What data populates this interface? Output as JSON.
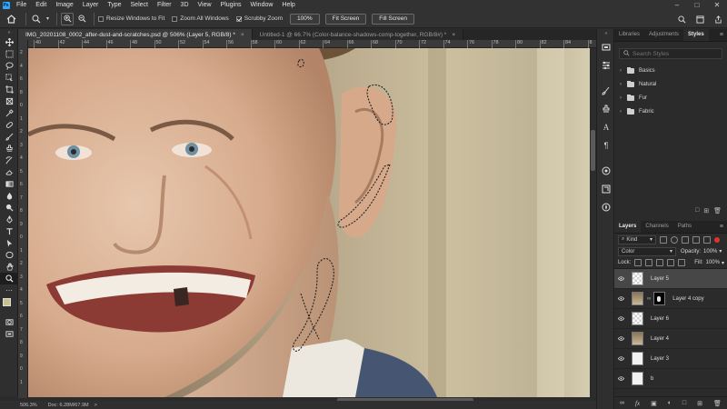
{
  "menubar": {
    "app_logo": "Ps",
    "items": [
      "File",
      "Edit",
      "Image",
      "Layer",
      "Type",
      "Select",
      "Filter",
      "3D",
      "View",
      "Plugins",
      "Window",
      "Help"
    ]
  },
  "options": {
    "resize_windows_label": "Resize Windows to Fit",
    "resize_windows_checked": false,
    "zoom_all_label": "Zoom All Windows",
    "zoom_all_checked": false,
    "scrubby_label": "Scrubby Zoom",
    "scrubby_checked": true,
    "zoom_100_label": "100%",
    "fit_screen_label": "Fit Screen",
    "fill_screen_label": "Fill Screen"
  },
  "tabs": [
    {
      "label": "IMG_20201108_0002_after-dust-and-scratches.psd @ 506% (Layer 5, RGB/8) *",
      "active": true
    },
    {
      "label": "Untitled-1 @ 66.7% (Color-balance-shadows-comp-together, RGB/8#) *",
      "active": false
    }
  ],
  "ruler": {
    "h_ticks": [
      "40",
      "42",
      "44",
      "46",
      "48",
      "50",
      "52",
      "54",
      "56",
      "58",
      "60",
      "62",
      "64",
      "66",
      "68",
      "70",
      "72",
      "74",
      "76",
      "78",
      "80",
      "82",
      "84",
      "8"
    ],
    "v_ticks": [
      "2",
      "4",
      "6",
      "8",
      "0",
      "1",
      "2",
      "3",
      "4",
      "5",
      "6",
      "7",
      "8",
      "9",
      "0",
      "1",
      "2",
      "3",
      "4",
      "5",
      "6",
      "7",
      "8",
      "9",
      "0",
      "1"
    ]
  },
  "status": {
    "zoom": "506.3%",
    "doc": "Doc: 6.28M/67.9M",
    "arrow": ">"
  },
  "styles_panel": {
    "tabs": [
      "Libraries",
      "Adjustments",
      "Styles"
    ],
    "active_tab": "Styles",
    "search_placeholder": "Search Styles",
    "folders": [
      "Basics",
      "Natural",
      "Fur",
      "Fabric"
    ]
  },
  "layers_panel": {
    "tabs": [
      "Layers",
      "Channels",
      "Paths"
    ],
    "active_tab": "Layers",
    "filter_kind": "Kind",
    "blend_mode": "Color",
    "opacity_label": "Opacity:",
    "opacity_value": "100%",
    "lock_label": "Lock:",
    "fill_label": "Fill:",
    "fill_value": "100%",
    "layers": [
      {
        "name": "Layer 5",
        "thumb": "transparent",
        "selected": true,
        "mask": false
      },
      {
        "name": "Layer 4 copy",
        "thumb": "photo",
        "selected": false,
        "mask": true
      },
      {
        "name": "Layer 6",
        "thumb": "transparent",
        "selected": false,
        "mask": false
      },
      {
        "name": "Layer 4",
        "thumb": "photo",
        "selected": false,
        "mask": false
      },
      {
        "name": "Layer 3",
        "thumb": "white",
        "selected": false,
        "mask": false
      },
      {
        "name": "b",
        "thumb": "white",
        "selected": false,
        "mask": false
      }
    ]
  },
  "colors": {
    "foreground": "#c8c190",
    "background": "#ffffff",
    "accent": "#31a8ff"
  }
}
